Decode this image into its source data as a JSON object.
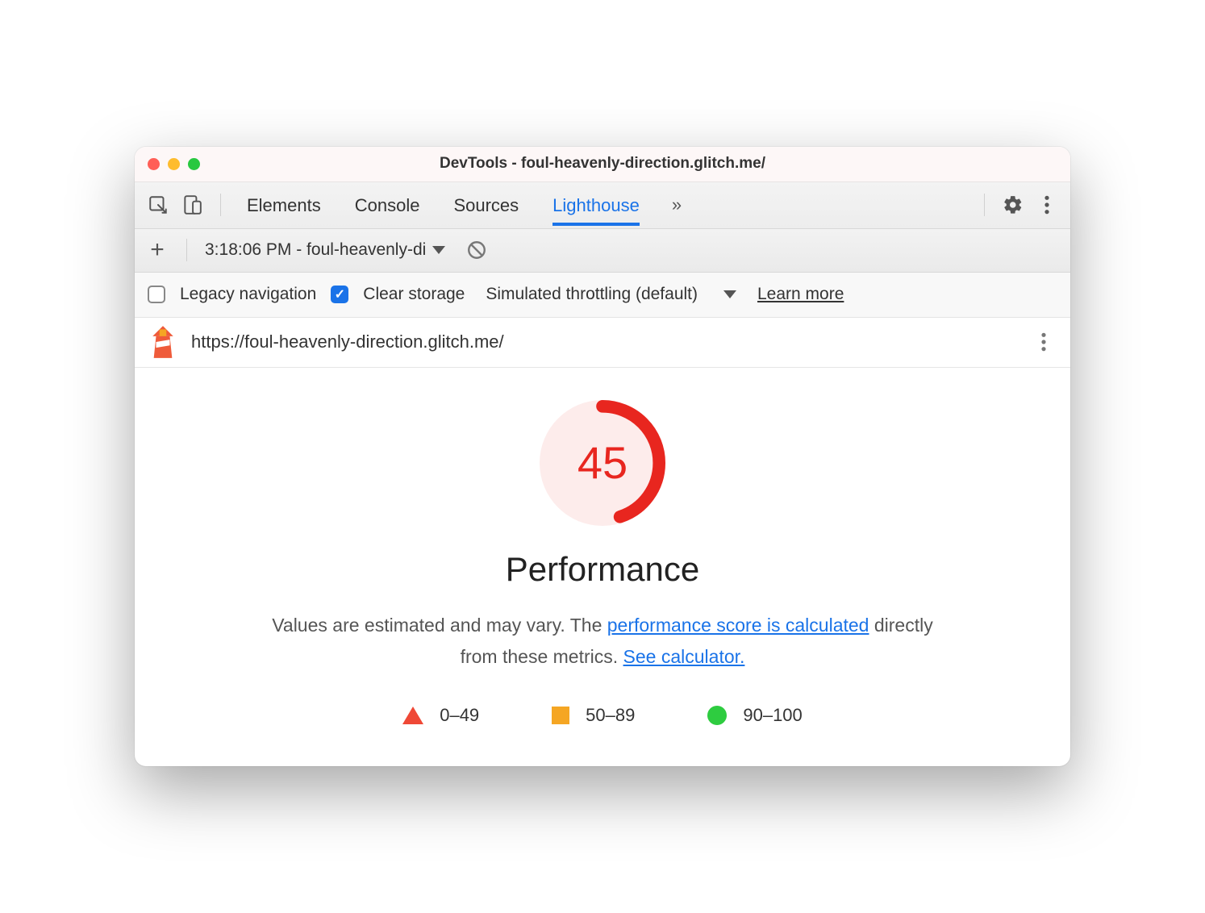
{
  "window": {
    "title": "DevTools - foul-heavenly-direction.glitch.me/"
  },
  "tabs": {
    "items": [
      "Elements",
      "Console",
      "Sources",
      "Lighthouse"
    ],
    "active": "Lighthouse"
  },
  "toolbar": {
    "run_label": "3:18:06 PM - foul-heavenly-di"
  },
  "options": {
    "legacy_label": "Legacy navigation",
    "clear_label": "Clear storage",
    "throttling_label": "Simulated throttling (default)",
    "learn_label": "Learn more"
  },
  "url_row": {
    "url": "https://foul-heavenly-direction.glitch.me/"
  },
  "report": {
    "score": "45",
    "score_value": 45,
    "category": "Performance",
    "desc_prefix": "Values are estimated and may vary. The ",
    "link1": "performance score is calculated",
    "desc_mid": " directly from these metrics. ",
    "link2": "See calculator.",
    "legend": {
      "r0": "0–49",
      "r1": "50–89",
      "r2": "90–100"
    }
  },
  "colors": {
    "accent_blue": "#1a73e8",
    "score_red": "#e8261f",
    "gauge_bg": "#fdeceb"
  }
}
